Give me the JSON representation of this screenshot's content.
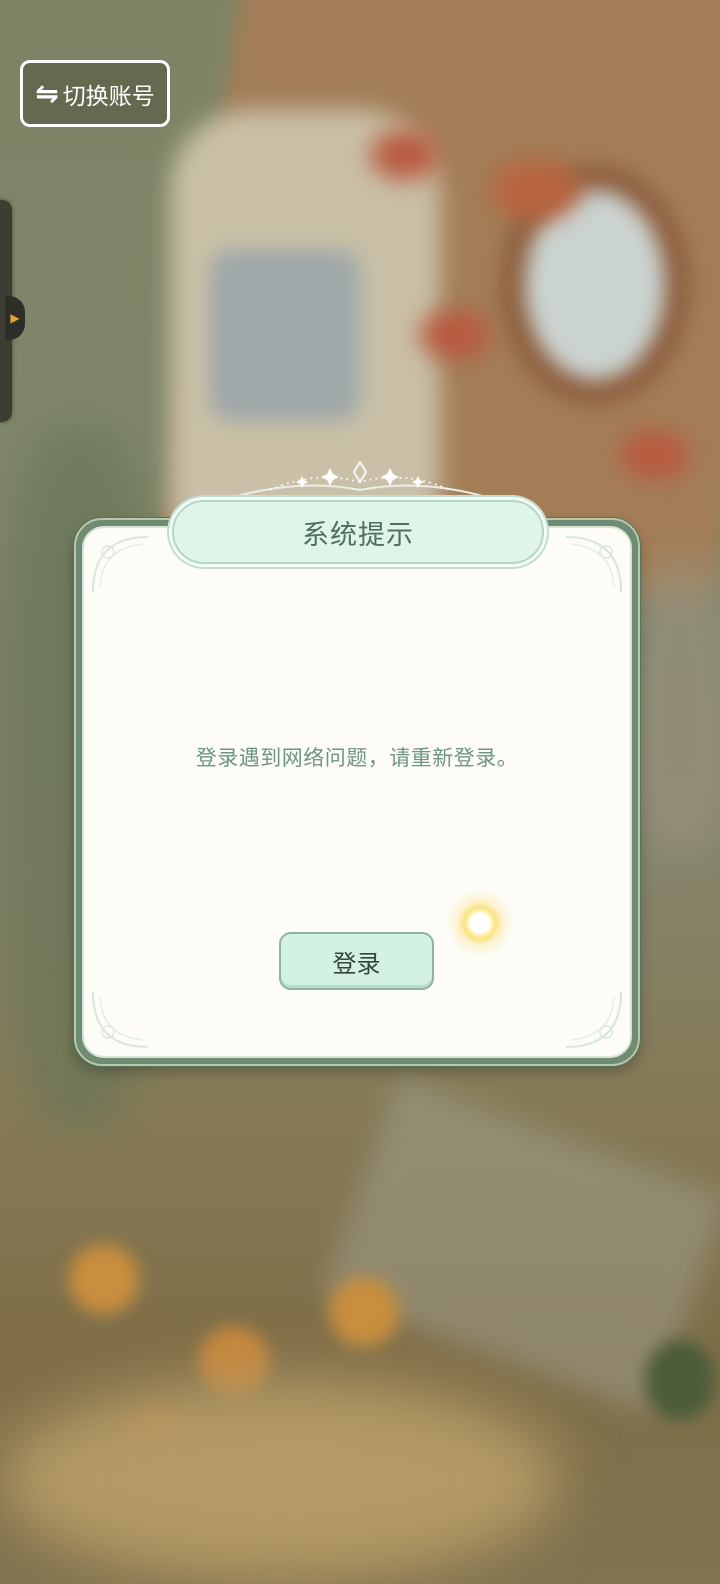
{
  "top_bar": {
    "switch_account_label": "切换账号",
    "switch_icon_glyph": "⇋"
  },
  "side_tab": {
    "arrow_glyph": "▶",
    "arrow_color": "#e3a43c"
  },
  "dialog": {
    "title": "系统提示",
    "message": "登录遇到网络问题，请重新登录。",
    "login_button_label": "登录",
    "colors": {
      "panel": "#fdfcf6",
      "frame": "#6f8b73",
      "banner": "#dff5ea",
      "title_text": "#4f6f62",
      "message_text": "#6f9586",
      "button_fill": "#d4f2e2"
    }
  }
}
